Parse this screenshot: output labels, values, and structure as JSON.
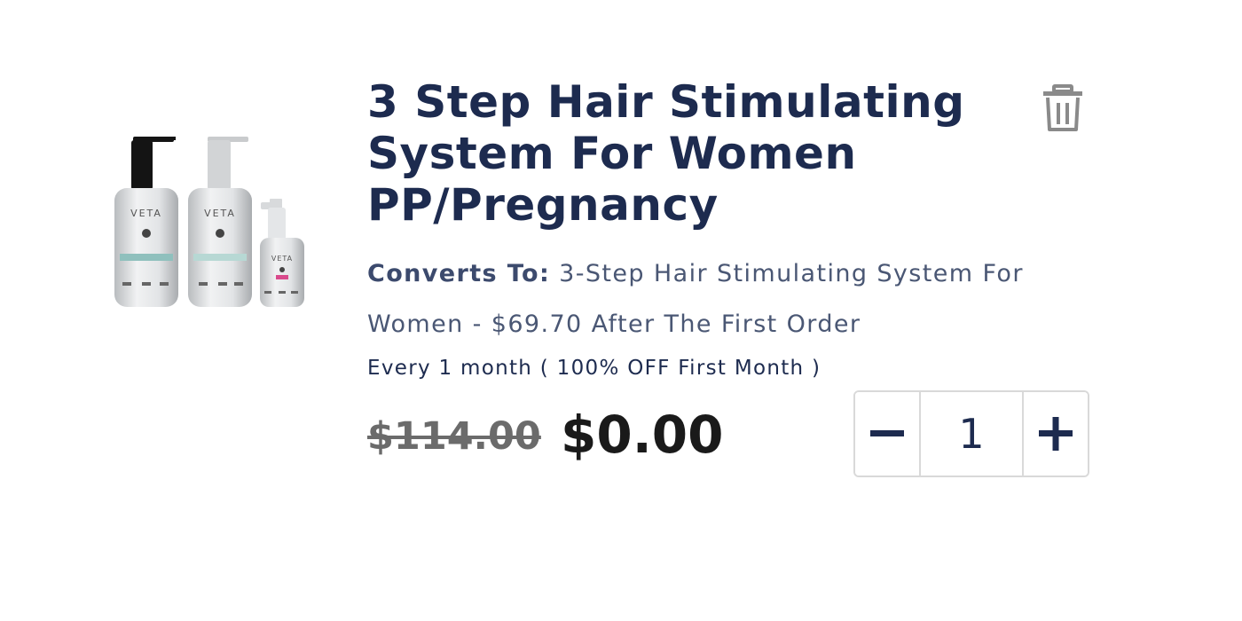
{
  "product": {
    "title": "3 Step Hair Stimulating System For Women PP/Pregnancy",
    "image_brand_text": "VETA",
    "image_icon": "product-bottles-image"
  },
  "subscription": {
    "converts_label": "Converts To:",
    "converts_text": " 3-Step Hair Stimulating System For Women - $69.70 After The First Order",
    "billing_text": "Every 1 month ( 100% OFF First Month )"
  },
  "pricing": {
    "original_price": "$114.00",
    "current_price": "$0.00"
  },
  "quantity": {
    "value": "1",
    "decrease_icon": "minus-icon",
    "increase_icon": "plus-icon"
  },
  "actions": {
    "delete_icon": "trash-icon"
  },
  "colors": {
    "title": "#1d2b4f",
    "body": "#4a5774",
    "price_current": "#1a1a1a",
    "price_original": "#6b6b6b",
    "border": "#d9d9d9"
  }
}
